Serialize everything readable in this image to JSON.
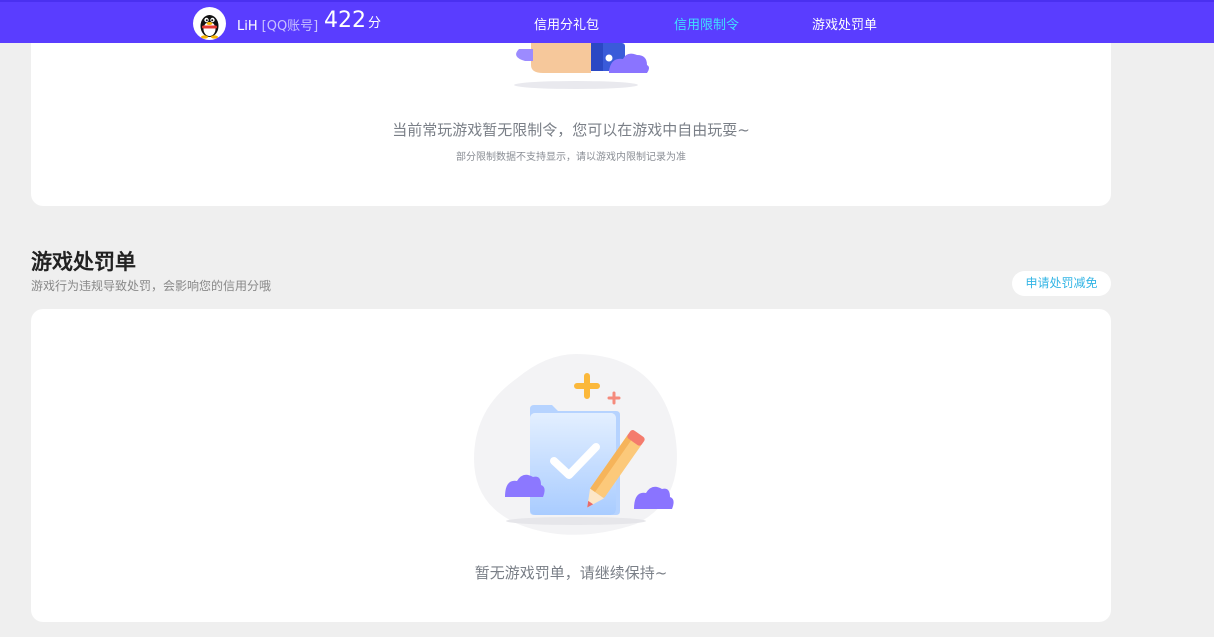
{
  "header": {
    "username": "LiH",
    "account_type": "[QQ账号]",
    "score": "422",
    "score_unit": "分",
    "tabs": [
      {
        "label": "信用分礼包",
        "active": false
      },
      {
        "label": "信用限制令",
        "active": true
      },
      {
        "label": "游戏处罚单",
        "active": false
      }
    ],
    "colors": {
      "nav_bg": "#5a3dff",
      "active_tab": "#3fe1ff"
    }
  },
  "restriction": {
    "empty_text": "当前常玩游戏暂无限制令，您可以在游戏中自由玩耍~",
    "note": "部分限制数据不支持显示，请以游戏内限制记录为准"
  },
  "penalty": {
    "title": "游戏处罚单",
    "subtitle": "游戏行为违规导致处罚，会影响您的信用分哦",
    "appeal_button": "申请处罚减免",
    "empty_text": "暂无游戏罚单，请继续保持~"
  }
}
